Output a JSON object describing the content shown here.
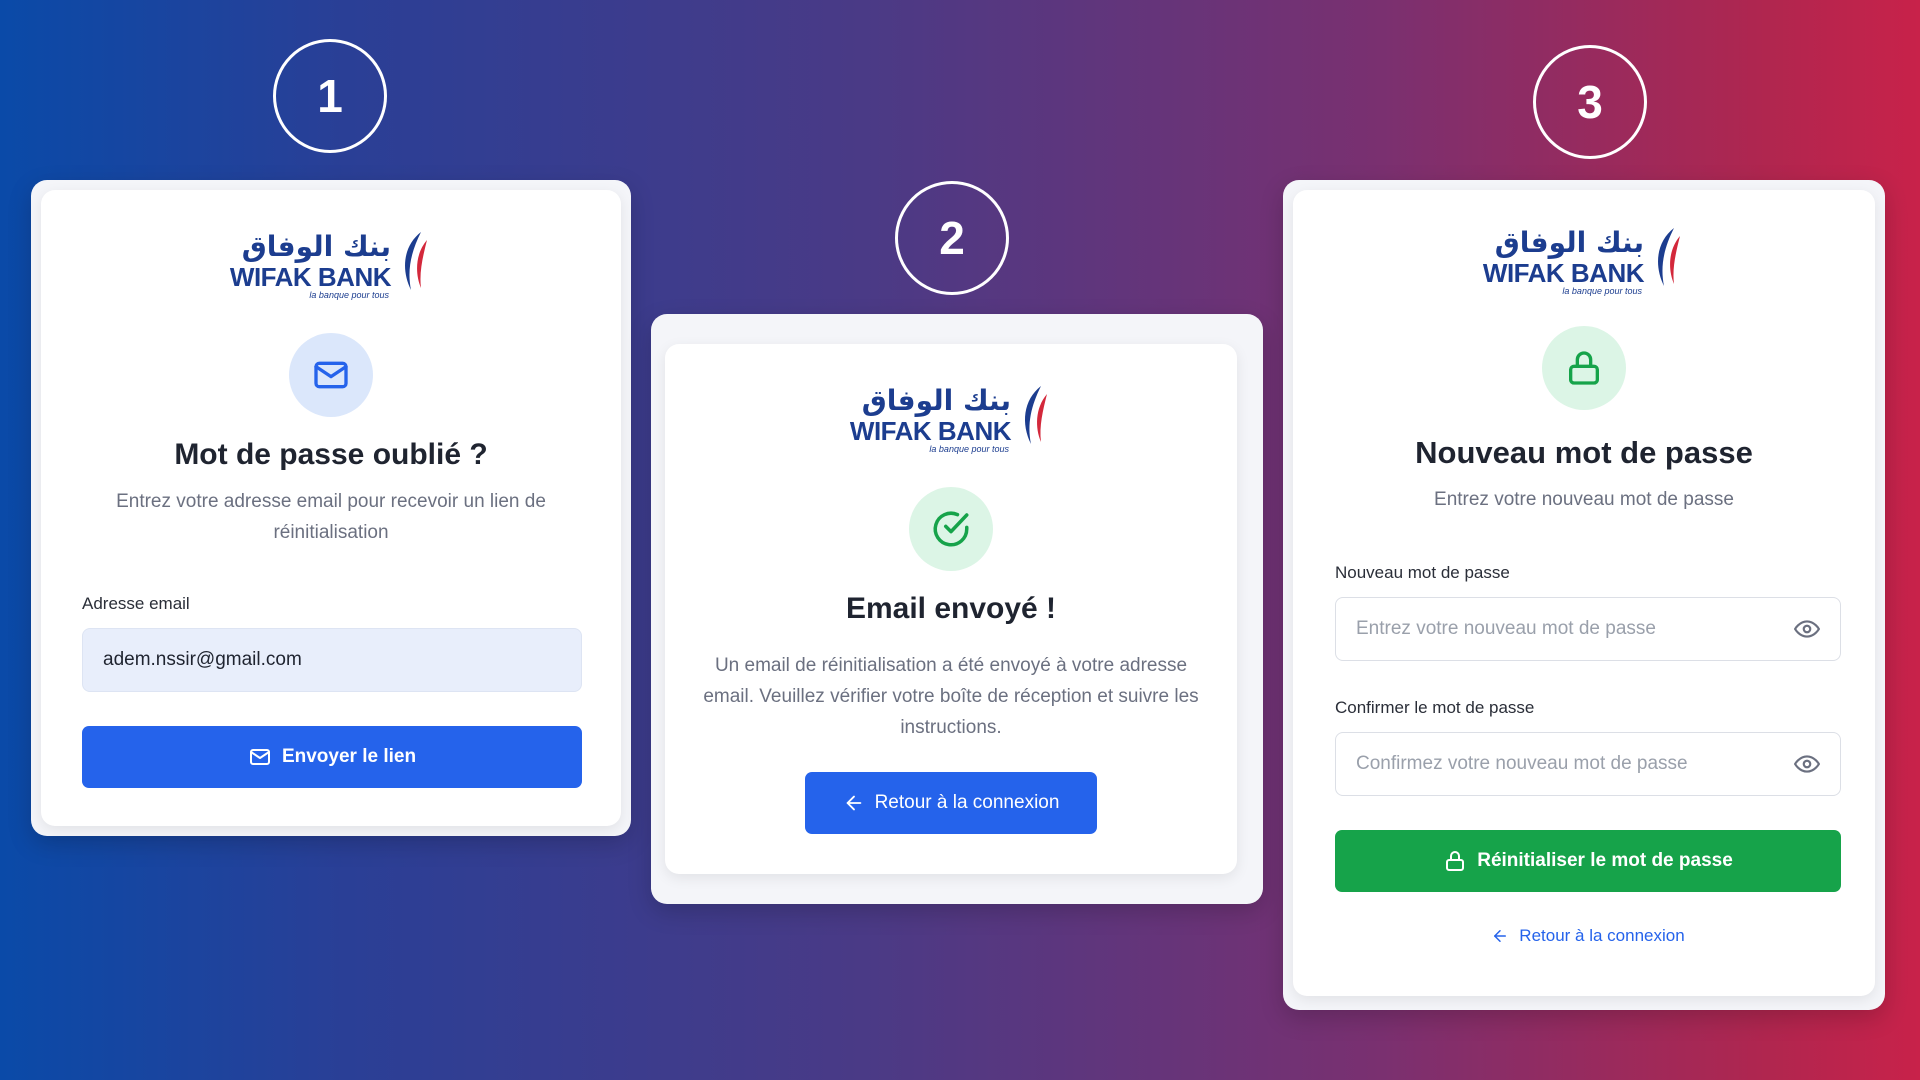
{
  "steps": [
    "1",
    "2",
    "3"
  ],
  "brand": {
    "arabic": "بنك الوفاق",
    "name": "WIFAK BANK",
    "tagline": "la banque pour tous"
  },
  "colors": {
    "primary": "#2563eb",
    "success": "#16a34a",
    "badge_blue": "#dbe7fb",
    "badge_green": "#dcf5e6"
  },
  "card1": {
    "icon": "mail-icon",
    "title": "Mot de passe oublié ?",
    "subtitle": "Entrez votre adresse email pour recevoir un lien de réinitialisation",
    "email_label": "Adresse email",
    "email_value": "adem.nssir@gmail.com",
    "button": "Envoyer le lien"
  },
  "card2": {
    "icon": "check-circle-icon",
    "title": "Email envoyé !",
    "message": "Un email de réinitialisation a été envoyé à votre adresse email. Veuillez vérifier votre boîte de réception et suivre les instructions.",
    "button": "Retour à la connexion"
  },
  "card3": {
    "icon": "lock-icon",
    "title": "Nouveau mot de passe",
    "subtitle": "Entrez votre nouveau mot de passe",
    "new_label": "Nouveau mot de passe",
    "new_placeholder": "Entrez votre nouveau mot de passe",
    "confirm_label": "Confirmer le mot de passe",
    "confirm_placeholder": "Confirmez votre nouveau mot de passe",
    "button": "Réinitialiser le mot de passe",
    "back_link": "Retour à la connexion"
  }
}
